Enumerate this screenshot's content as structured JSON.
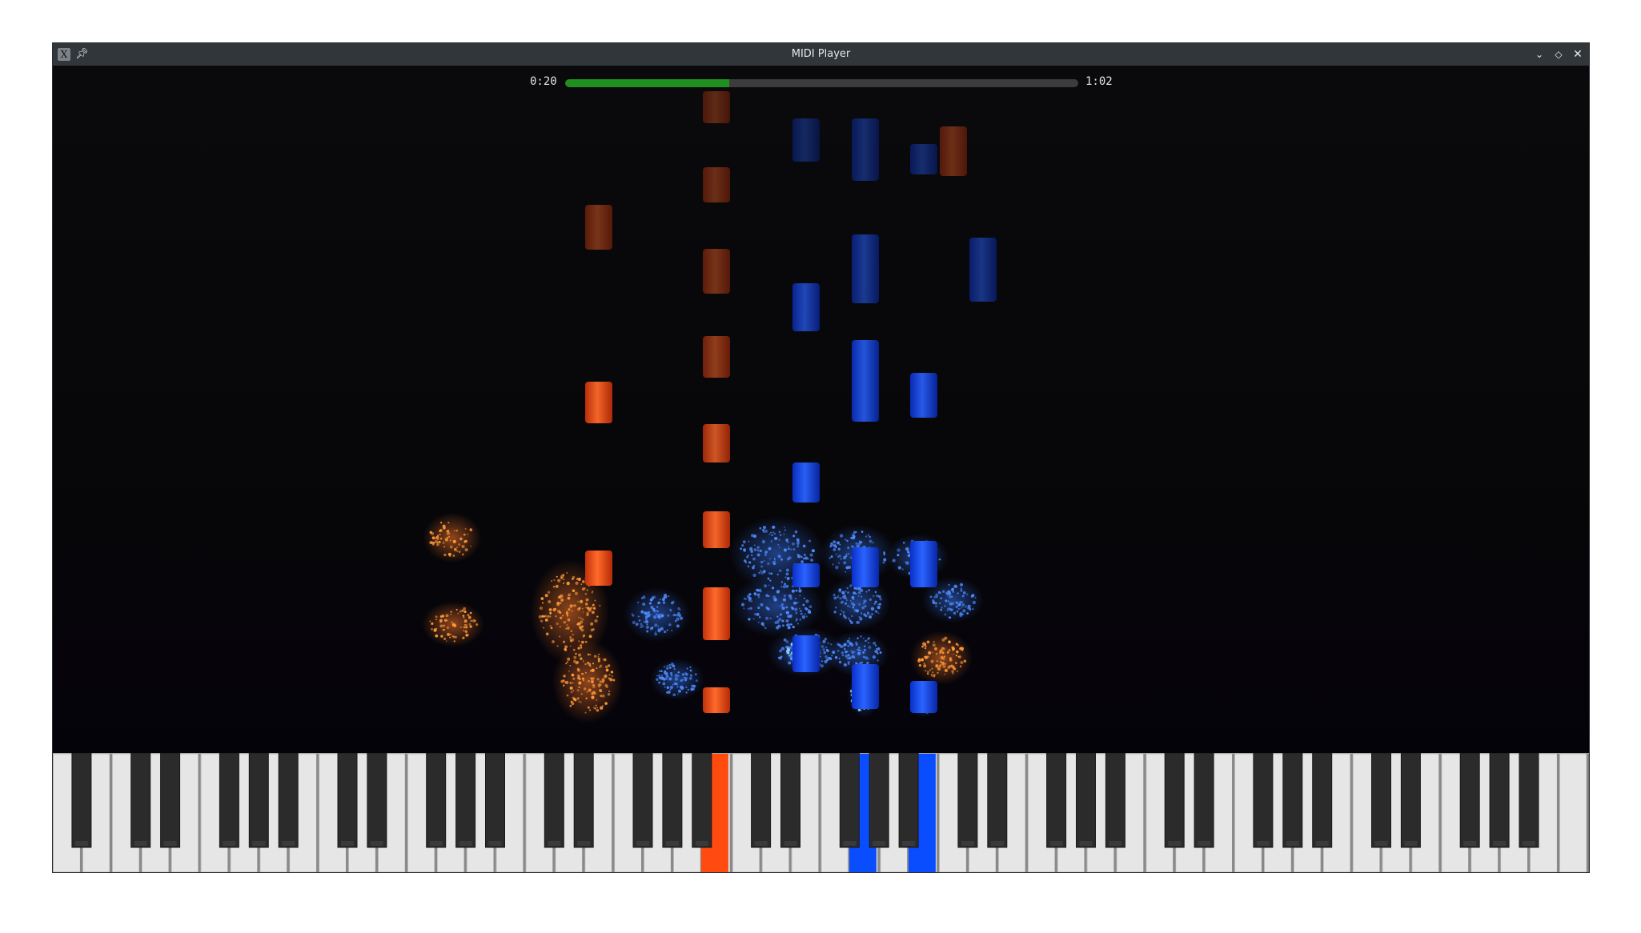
{
  "window": {
    "title": "MIDI Player",
    "icons": {
      "app": "x11-app-icon",
      "pin": "pin-icon",
      "minimize": "chevron-down-icon",
      "maximize": "diamond-icon",
      "close": "close-icon"
    },
    "app_icon_glyph": "X"
  },
  "progress": {
    "current": "0:20",
    "total": "1:02",
    "fraction": 0.32,
    "fill_color": "#1f8f1f"
  },
  "colors": {
    "left_hand": "#ff4a10",
    "right_hand": "#0a4dff"
  },
  "pressed_keys": [
    {
      "hand": "left",
      "color": "#ff4a10"
    },
    {
      "hand": "right",
      "color": "#0a4dff"
    },
    {
      "hand": "right",
      "color": "#0a4dff"
    }
  ]
}
